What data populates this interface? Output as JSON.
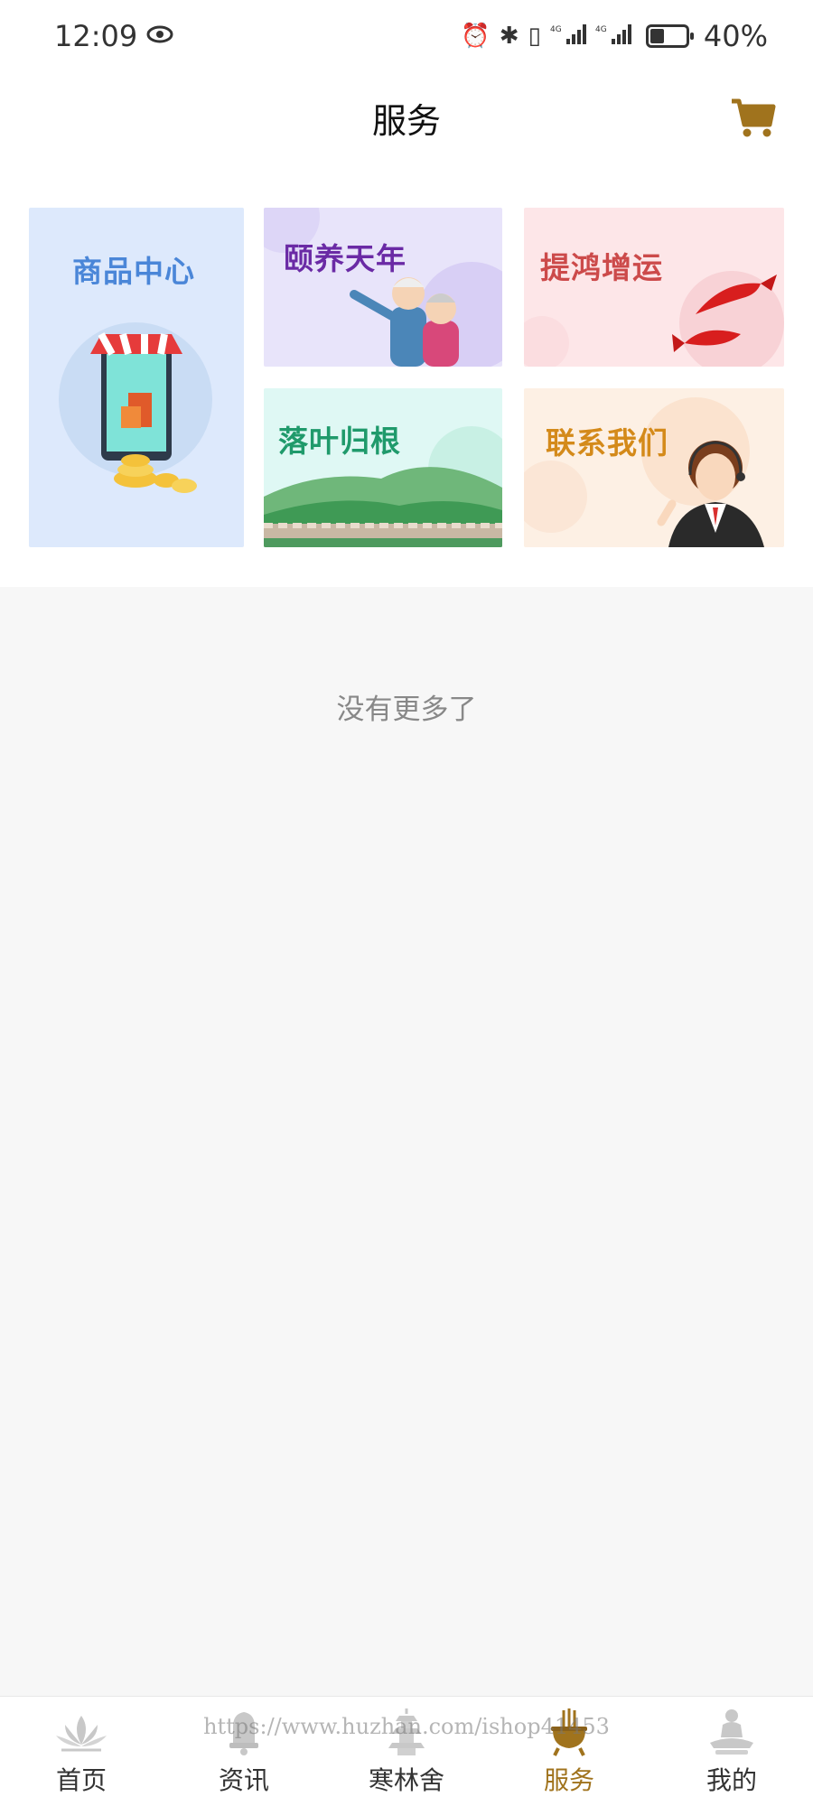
{
  "status_bar": {
    "time": "12:09",
    "battery": "40%",
    "battery_level": 0.4
  },
  "header": {
    "title": "服务"
  },
  "services": [
    {
      "label": "商品中心",
      "color": "#4a86d8",
      "bg": "#dde9fc"
    },
    {
      "label": "颐养天年",
      "color": "#6a2aa5",
      "bg": "#e8e4fa"
    },
    {
      "label": "提鸿增运",
      "color": "#cc4a4a",
      "bg": "#fde6e8"
    },
    {
      "label": "落叶归根",
      "color": "#1f9a6b",
      "bg": "#dff8f4"
    },
    {
      "label": "联系我们",
      "color": "#d48a1a",
      "bg": "#fdf0e4"
    }
  ],
  "footer_text": "没有更多了",
  "tabs": [
    {
      "label": "首页",
      "icon": "lotus-icon"
    },
    {
      "label": "资讯",
      "icon": "bell-icon"
    },
    {
      "label": "寒林舍",
      "icon": "pagoda-icon"
    },
    {
      "label": "服务",
      "icon": "incense-burner-icon",
      "active": true
    },
    {
      "label": "我的",
      "icon": "buddha-icon"
    }
  ],
  "watermark": "https://www.huzhan.com/ishop41453",
  "colors": {
    "accent": "#a0731d",
    "page_bg": "#f7f7f7"
  }
}
